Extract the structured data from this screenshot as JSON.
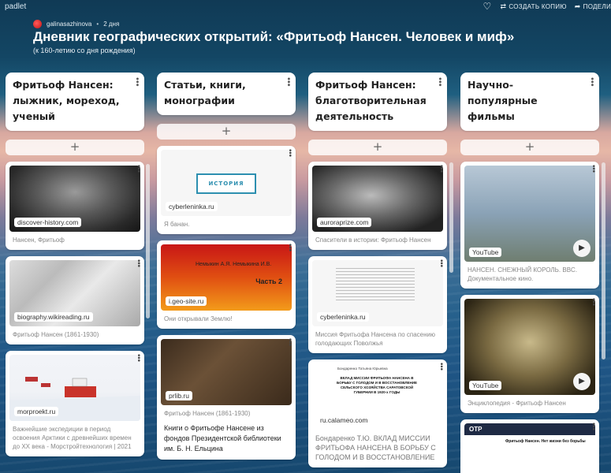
{
  "app": {
    "brand": "padlet"
  },
  "top_actions": {
    "copy_label": "СОЗДАТЬ КОПИЮ",
    "share_label": "ПОДЕЛИ"
  },
  "author": {
    "name": "galinasazhinova",
    "time": "2 дня"
  },
  "board": {
    "title": "Дневник географических открытий: «Фритьоф Нансен. Человек и миф»",
    "subtitle": "(к 160-летию со дня рождения)"
  },
  "columns": [
    {
      "title": "Фритьоф Нансен: лыжник, мореход, ученый",
      "cards": [
        {
          "source": "discover-history.com",
          "caption": "Нансен, Фритьоф"
        },
        {
          "source": "biography.wikireading.ru",
          "caption": "Фритьоф Нансен (1861-1930)"
        },
        {
          "source": "morproekt.ru",
          "caption": "Важнейшие экспедиции в период освоения Арктики с древнейших времен до XX века - Морстройтехнология | 2021"
        }
      ]
    },
    {
      "title": "Статьи, книги, монографии",
      "cards": [
        {
          "source": "cyberleninka.ru",
          "caption": "Я банан.",
          "media_text": "ИСТОРИЯ"
        },
        {
          "source": "i.geo-site.ru",
          "caption": "Они открывали Землю!",
          "media_text": "Немыкин А.Я.  Немыкина И.В.",
          "media_text2": "Часть 2"
        },
        {
          "source": "prlib.ru",
          "caption": "Фритьоф Нансен (1861-1930)",
          "note": "Книги о Фритьофе Нансене из фондов Президентской библиотеки им. Б. Н. Ельцина"
        }
      ]
    },
    {
      "title": "Фритьоф Нансен: благотворительная деятельность",
      "cards": [
        {
          "source": "auroraprize.com",
          "caption": "Спасители в истории: Фритьоф Нансен"
        },
        {
          "source": "cyberleninka.ru",
          "caption": "Миссия Фритьофа Нансена по спасению голодающих Поволжья"
        },
        {
          "source": "ru.calameo.com",
          "caption": "Бондаренко Т.Ю. ВКЛАД МИССИИ ФРИТЬОФА НАНСЕНА В БОРЬБУ С ГОЛОДОМ И В ВОССТАНОВЛЕНИЕ",
          "media_text": "ВКЛАД МИССИИ ФРИТЬОФА НАНСЕНА В БОРЬБУ С ГОЛОДОМ И В ВОССТАНОВЛЕНИЕ СЕЛЬСКОГО ХОЗЯЙСТВА САРАТОВСКОЙ ГУБЕРНИИ В 1920-х ГОДЫ",
          "media_author": "Бондаренко Татьяна Юрьевна"
        }
      ]
    },
    {
      "title": "Научно-популярные фильмы",
      "cards": [
        {
          "source": "YouTube",
          "caption": "НАНСЕН. СНЕЖНЫЙ КОРОЛЬ. BBC. Документальное кино."
        },
        {
          "source": "YouTube",
          "caption": "Энциклопедия - Фритьоф Нансен"
        },
        {
          "source": "",
          "caption": "",
          "media_text": "ОТР",
          "media_text2": "Фритьоф Нансен. Нет жизни без борьбы"
        }
      ]
    }
  ],
  "colors": {
    "accent_red": "#c81616",
    "card_bg": "#ffffff",
    "header_text": "#ffffff"
  }
}
